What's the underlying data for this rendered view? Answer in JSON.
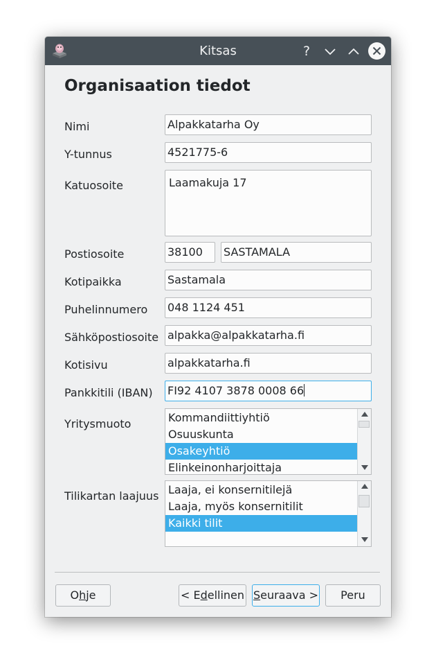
{
  "window": {
    "title": "Kitsas"
  },
  "titlebar": {
    "help_glyph": "?",
    "icons": [
      "app-icon",
      "help-icon",
      "minimize-icon",
      "maximize-icon",
      "close-icon"
    ]
  },
  "page": {
    "heading": "Organisaation tiedot"
  },
  "form": {
    "name": {
      "label": "Nimi",
      "value": "Alpakkatarha Oy"
    },
    "business_id": {
      "label": "Y-tunnus",
      "value": "4521775-6"
    },
    "street_address": {
      "label": "Katuosoite",
      "value": "Laamakuja 17"
    },
    "postal": {
      "label": "Postiosoite",
      "postcode": "38100",
      "city": "SASTAMALA"
    },
    "domicile": {
      "label": "Kotipaikka",
      "value": "Sastamala"
    },
    "phone": {
      "label": "Puhelinnumero",
      "value": "048 1124 451"
    },
    "email": {
      "label": "Sähköpostiosoite",
      "value": "alpakka@alpakkatarha.fi"
    },
    "website": {
      "label": "Kotisivu",
      "value": "alpakkatarha.fi"
    },
    "iban": {
      "label": "Pankkitili (IBAN)",
      "value": "FI92 4107 3878 0008 66"
    },
    "company_form": {
      "label": "Yritysmuoto",
      "items": [
        "Kommandiittiyhtiö",
        "Osuuskunta",
        "Osakeyhtiö",
        "Elinkeinonharjoittaja"
      ],
      "selected": "Osakeyhtiö"
    },
    "chart_scope": {
      "label": "Tilikartan laajuus",
      "items": [
        "Laaja, ei konsernitilejä",
        "Laaja, myös konsernitilit",
        "Kaikki tilit"
      ],
      "selected": "Kaikki tilit"
    }
  },
  "buttons": {
    "help": {
      "label": "Ohje",
      "mnemonic": "h"
    },
    "back": {
      "label": "< Edellinen",
      "mnemonic": "d"
    },
    "next": {
      "label": "Seuraava >",
      "mnemonic": "S"
    },
    "cancel": {
      "label": "Peru"
    }
  },
  "colors": {
    "titlebar": "#475057",
    "window_bg": "#eff0f1",
    "selection": "#3daee9",
    "focus_border": "#3daee9"
  }
}
